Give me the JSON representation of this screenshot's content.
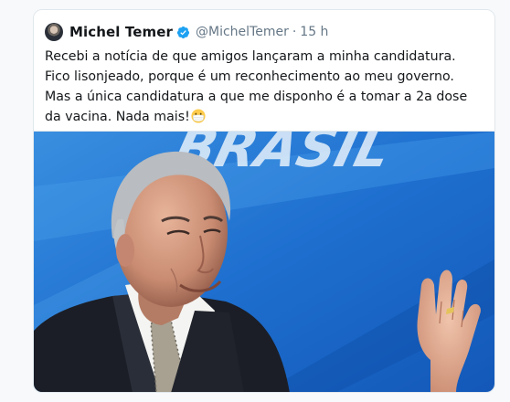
{
  "tweet": {
    "display_name": "Michel Temer",
    "verified_icon": "verified-badge-icon",
    "handle": "@MichelTemer",
    "separator": "·",
    "timestamp": "15 h",
    "text": "Recebi a notícia de que amigos lançaram a minha candidatura. Fico lisonjeado, porque é um reconhecimento ao meu governo. Mas a única candidatura a que me disponho é a tomar a 2a dose da vacina. Nada mais!",
    "emoji": "face-with-medical-mask-icon",
    "media": {
      "description_icon": "photo-man-waving",
      "background_text": "BRASIL"
    }
  },
  "colors": {
    "accent_blue": "#1da1f2",
    "text_primary": "#14171a",
    "text_secondary": "#657786",
    "border": "#e1e8ed"
  }
}
